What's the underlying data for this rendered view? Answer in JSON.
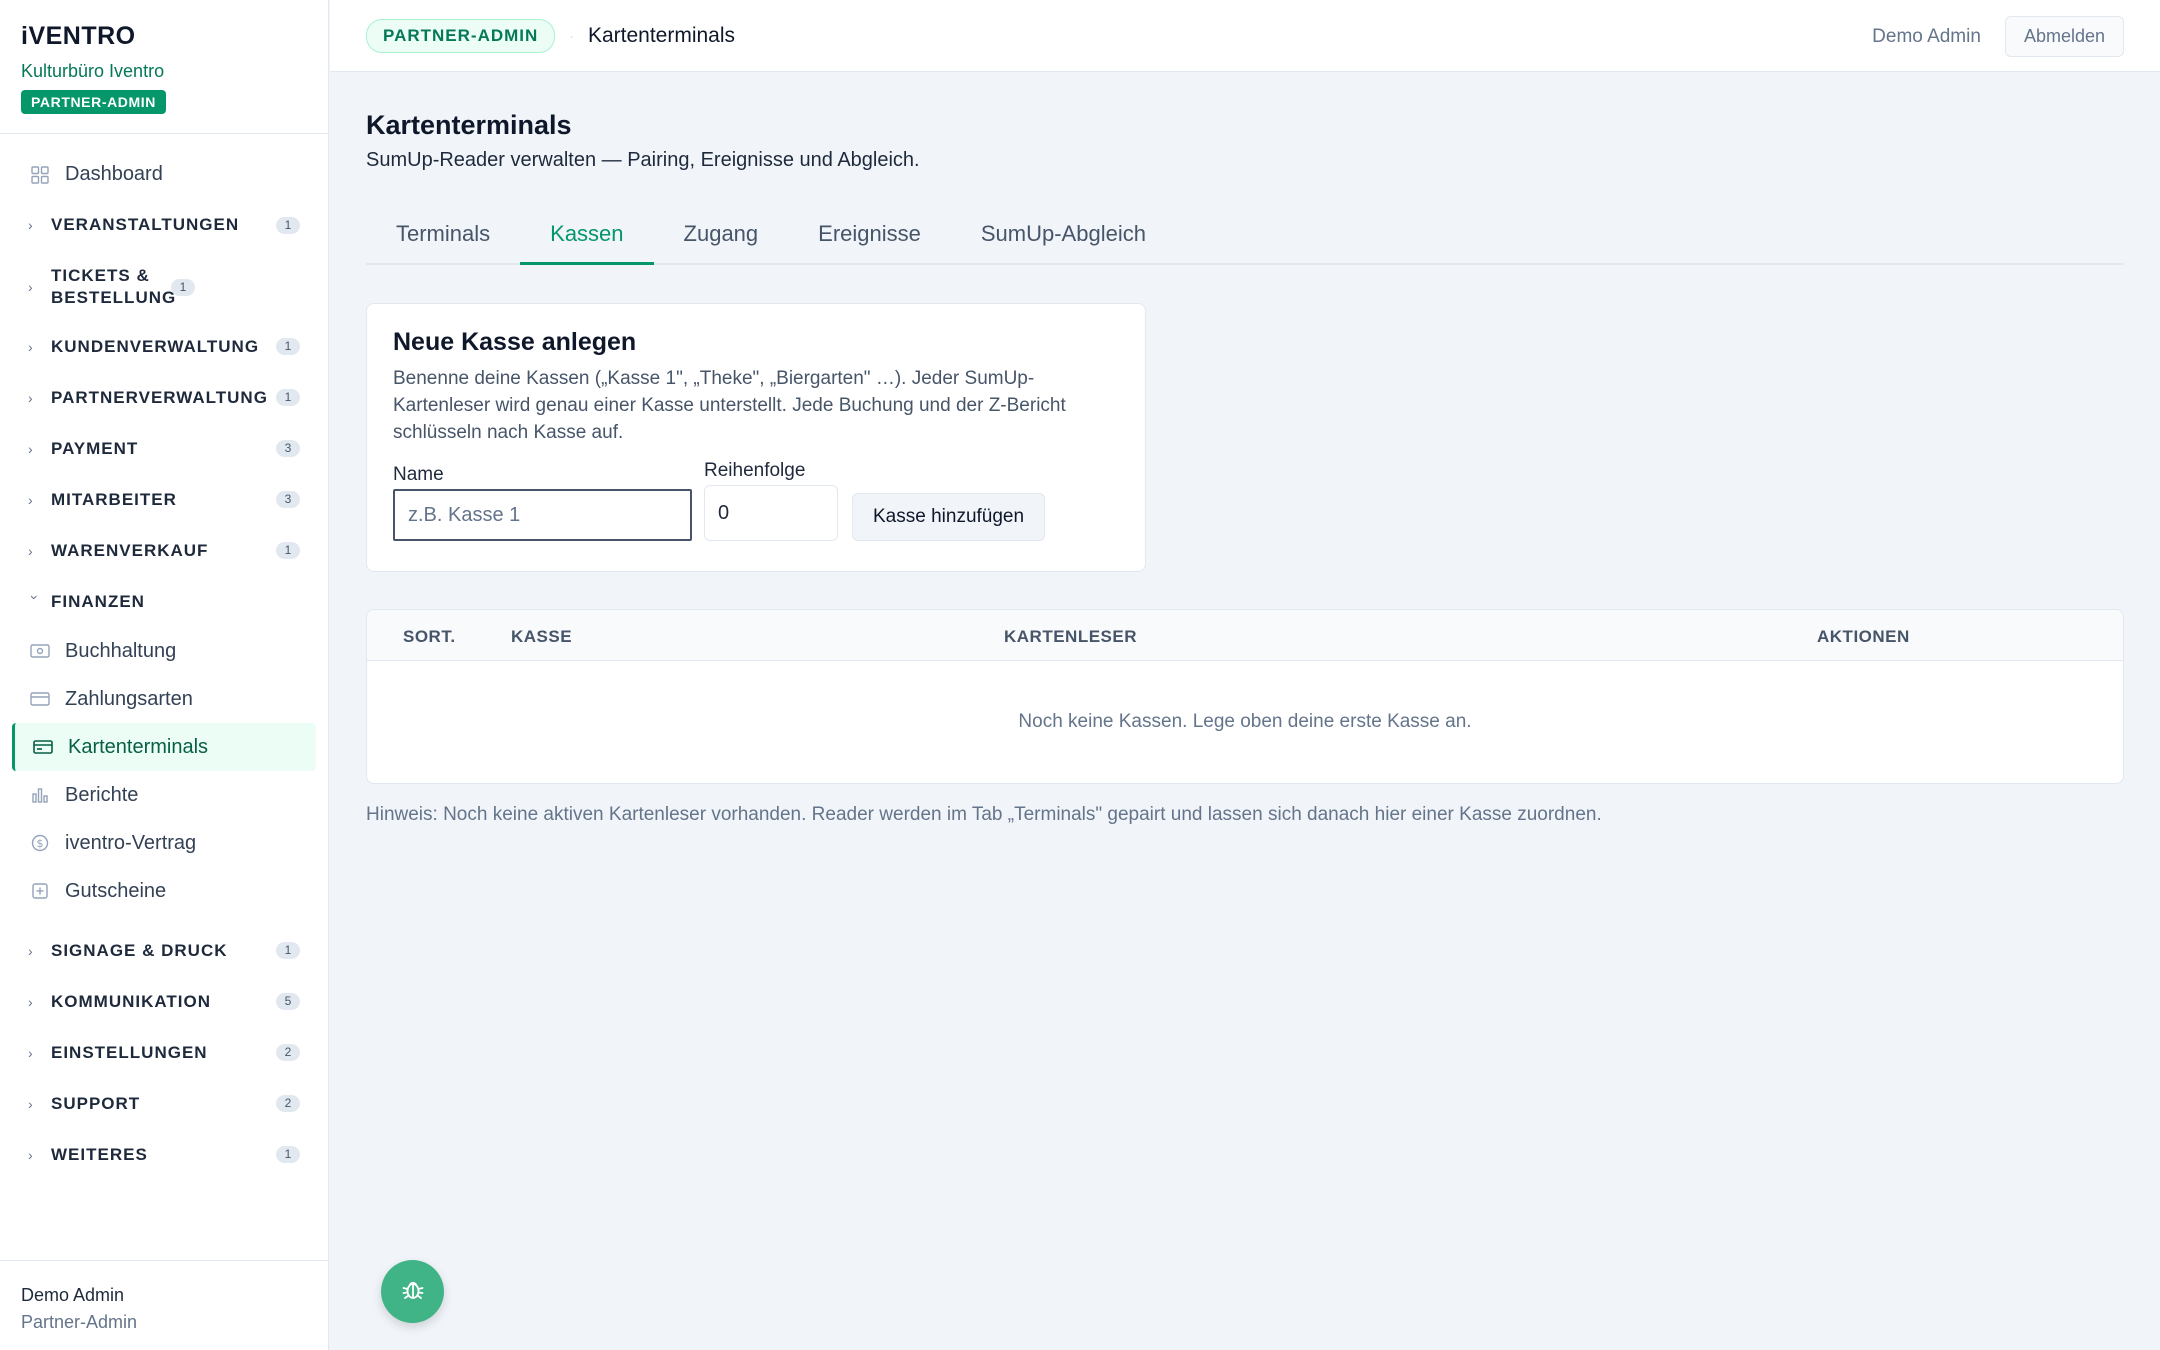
{
  "brand": {
    "logo": "iVENTRO",
    "org": "Kulturbüro Iventro",
    "role_badge": "PARTNER-ADMIN"
  },
  "sidebar": {
    "dashboard": "Dashboard",
    "groups": [
      {
        "label": "VERANSTALTUNGEN",
        "count": "1"
      },
      {
        "label": "TICKETS & BESTELLUNG",
        "count": "1"
      },
      {
        "label": "KUNDENVERWALTUNG",
        "count": "1"
      },
      {
        "label": "PARTNERVERWALTUNG",
        "count": "1"
      },
      {
        "label": "PAYMENT",
        "count": "3"
      },
      {
        "label": "MITARBEITER",
        "count": "3"
      },
      {
        "label": "WARENVERKAUF",
        "count": "1"
      },
      {
        "label": "FINANZEN",
        "count": ""
      },
      {
        "label": "SIGNAGE & DRUCK",
        "count": "1"
      },
      {
        "label": "KOMMUNIKATION",
        "count": "5"
      },
      {
        "label": "EINSTELLUNGEN",
        "count": "2"
      },
      {
        "label": "SUPPORT",
        "count": "2"
      },
      {
        "label": "WEITERES",
        "count": "1"
      }
    ],
    "finanzen_items": [
      {
        "label": "Buchhaltung",
        "icon": "cash-icon"
      },
      {
        "label": "Zahlungsarten",
        "icon": "card-icon"
      },
      {
        "label": "Kartenterminals",
        "icon": "card-terminal-icon"
      },
      {
        "label": "Berichte",
        "icon": "chart-icon"
      },
      {
        "label": "iventro-Vertrag",
        "icon": "dollar-circle-icon"
      },
      {
        "label": "Gutscheine",
        "icon": "voucher-icon"
      }
    ],
    "footer": {
      "user": "Demo Admin",
      "role": "Partner-Admin"
    }
  },
  "topbar": {
    "badge": "PARTNER-ADMIN",
    "separator": "·",
    "breadcrumb": "Kartenterminals",
    "user": "Demo Admin",
    "logout": "Abmelden"
  },
  "page": {
    "title": "Kartenterminals",
    "subtitle": "SumUp-Reader verwalten — Pairing, Ereignisse und Abgleich."
  },
  "tabs": [
    {
      "label": "Terminals",
      "active": false
    },
    {
      "label": "Kassen",
      "active": true
    },
    {
      "label": "Zugang",
      "active": false
    },
    {
      "label": "Ereignisse",
      "active": false
    },
    {
      "label": "SumUp-Abgleich",
      "active": false
    }
  ],
  "new_register": {
    "title": "Neue Kasse anlegen",
    "description": "Benenne deine Kassen („Kasse 1\", „Theke\", „Biergarten\" …). Jeder SumUp-Kartenleser wird genau einer Kasse unterstellt. Jede Buchung und der Z-Bericht schlüsseln nach Kasse auf.",
    "name_label": "Name",
    "name_placeholder": "z.B. Kasse 1",
    "order_label": "Reihenfolge",
    "order_value": "0",
    "add_button": "Kasse hinzufügen"
  },
  "table": {
    "headers": {
      "sort": "SORT.",
      "register": "KASSE",
      "reader": "KARTENLESER",
      "actions": "AKTIONEN"
    },
    "empty": "Noch keine Kassen. Lege oben deine erste Kasse an."
  },
  "hint": "Hinweis: Noch keine aktiven Kartenleser vorhanden. Reader werden im Tab „Terminals\" gepairt und lassen sich danach hier einer Kasse zuordnen.",
  "colors": {
    "accent": "#059669",
    "fab": "#41b487"
  }
}
